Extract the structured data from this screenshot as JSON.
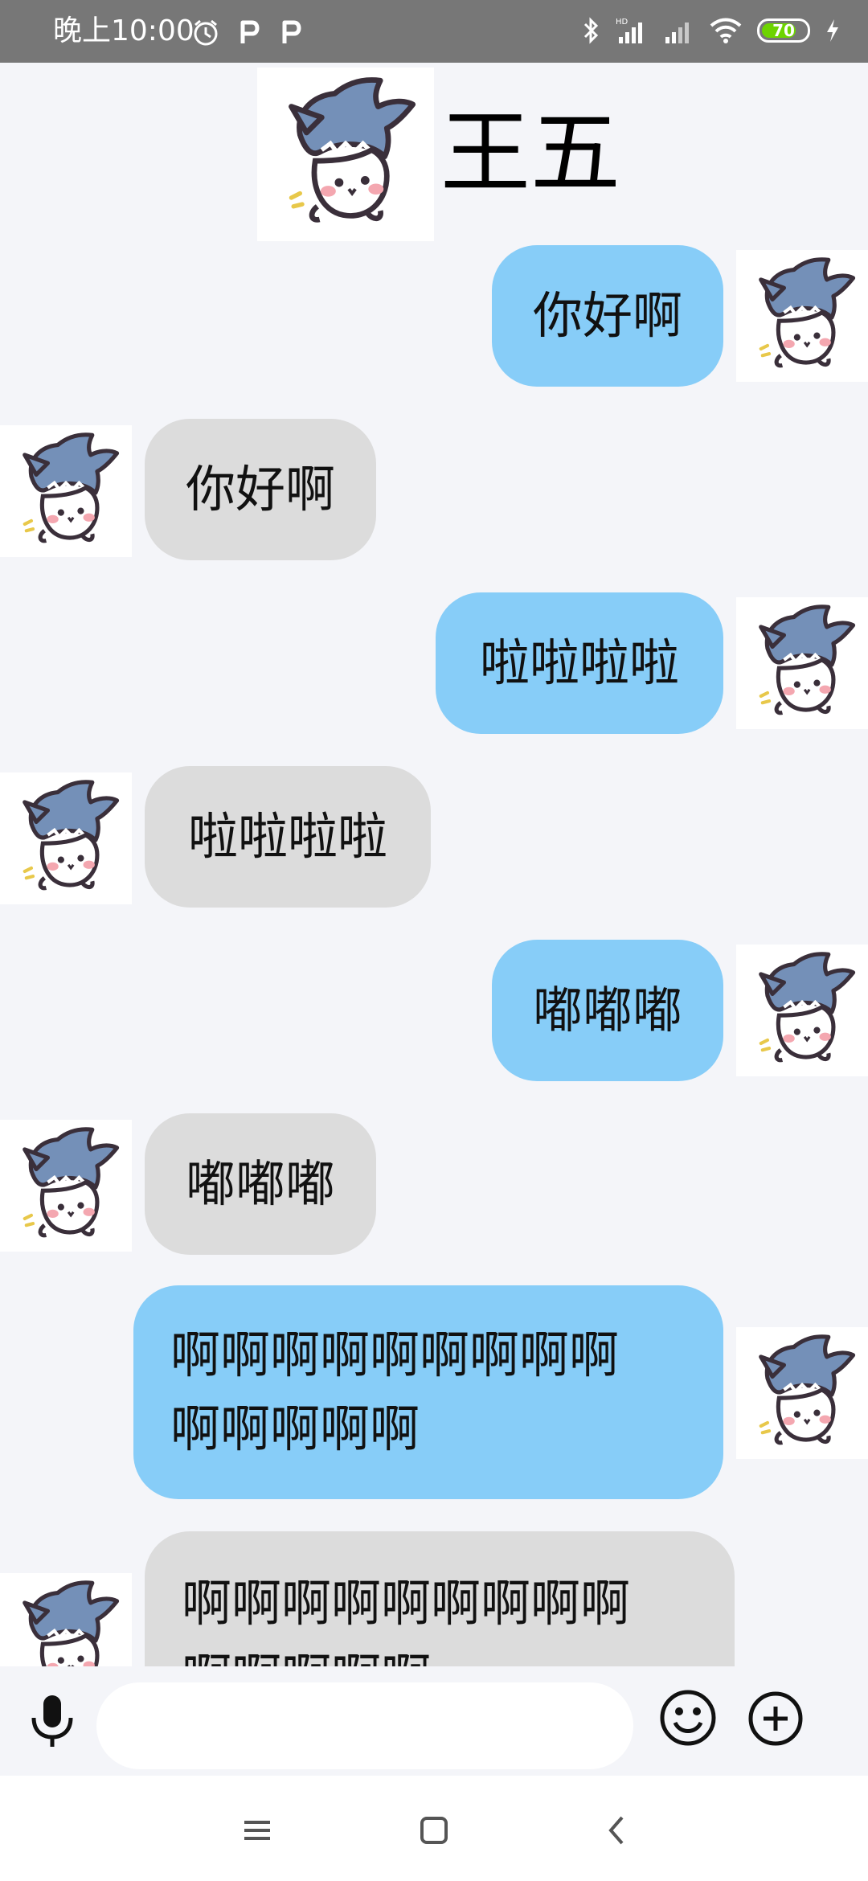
{
  "status_bar": {
    "time": "晚上10:00",
    "battery_level": "70",
    "icons": [
      "alarm-icon",
      "p-app-icon",
      "p-app-icon",
      "bluetooth-icon",
      "hd-signal-icon",
      "signal-icon",
      "wifi-icon",
      "battery-icon",
      "charging-icon"
    ]
  },
  "header": {
    "contact_name": "王五"
  },
  "messages": [
    {
      "from": "me",
      "text": "你好啊"
    },
    {
      "from": "other",
      "text": "你好啊"
    },
    {
      "from": "me",
      "text": "啦啦啦啦"
    },
    {
      "from": "other",
      "text": "啦啦啦啦"
    },
    {
      "from": "me",
      "text": "嘟嘟嘟"
    },
    {
      "from": "other",
      "text": "嘟嘟嘟"
    },
    {
      "from": "me",
      "text": "啊啊啊啊啊啊啊啊啊\n啊啊啊啊啊"
    },
    {
      "from": "other",
      "text": "啊啊啊啊啊啊啊啊啊\n啊啊啊啊啊"
    }
  ],
  "input_bar": {
    "placeholder": "",
    "value": "",
    "icons": [
      "microphone-icon",
      "emoji-icon",
      "plus-icon"
    ]
  },
  "nav_bar": {
    "icons": [
      "menu-icon",
      "home-icon",
      "back-icon"
    ]
  },
  "colors": {
    "my_bubble": "#87cdf8",
    "other_bubble": "#dcdcdc",
    "background": "#f4f5f9",
    "status_bar": "#777777"
  }
}
